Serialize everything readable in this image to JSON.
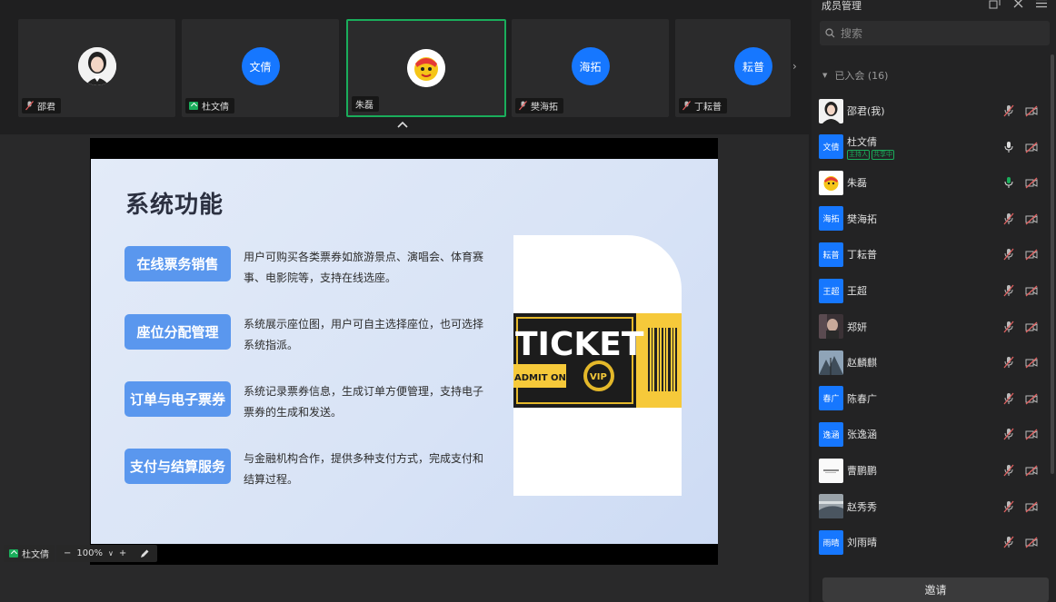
{
  "video_strip": {
    "tiles": [
      {
        "name": "邵君",
        "avatar_type": "photo",
        "muted": true
      },
      {
        "name": "杜文倩",
        "avatar_type": "text",
        "avatar_text": "文倩",
        "sharing": true
      },
      {
        "name": "朱磊",
        "avatar_type": "cartoon",
        "active": true
      },
      {
        "name": "樊海拓",
        "avatar_type": "text",
        "avatar_text": "海拓",
        "muted": true
      },
      {
        "name": "丁耘普",
        "avatar_type": "text",
        "avatar_text": "耘普",
        "muted": true
      }
    ],
    "next_icon": "chevron-right-icon",
    "collapse_icon": "chevron-up-icon"
  },
  "slide": {
    "title": "系统功能",
    "features": [
      {
        "label": "在线票务销售",
        "desc": "用户可购买各类票券如旅游景点、演唱会、体育赛事、电影院等，支持在线选座。"
      },
      {
        "label": "座位分配管理",
        "desc": "系统展示座位图，用户可自主选择座位，也可选择系统指派。"
      },
      {
        "label": "订单与电子票券",
        "desc": "系统记录票券信息，生成订单方便管理，支持电子票券的生成和发送。"
      },
      {
        "label": "支付与结算服务",
        "desc": "与金融机构合作，提供多种支付方式，完成支付和结算过程。"
      }
    ],
    "ticket": {
      "main": "TICKET",
      "admit": "ADMIT ONE",
      "vip": "VIP"
    }
  },
  "bottom_bar": {
    "sharer": "杜文倩",
    "zoom_minus": "−",
    "zoom_level": "100%",
    "zoom_dropdown": "∨",
    "zoom_plus": "+"
  },
  "panel": {
    "title": "成员管理",
    "search_placeholder": "搜索",
    "group_label": "已入会 (16)",
    "members": [
      {
        "name": "邵君(我)",
        "avatar_type": "photo",
        "mic": "muted",
        "camera": "off"
      },
      {
        "name": "杜文倩",
        "avatar_type": "text",
        "avatar_text": "文倩",
        "badges": [
          "主持人",
          "共享中"
        ],
        "mic": "on",
        "camera": "off"
      },
      {
        "name": "朱磊",
        "avatar_type": "cartoon",
        "mic": "speaking",
        "camera": "off"
      },
      {
        "name": "樊海拓",
        "avatar_type": "text",
        "avatar_text": "海拓",
        "mic": "muted",
        "camera": "off"
      },
      {
        "name": "丁耘普",
        "avatar_type": "text",
        "avatar_text": "耘普",
        "mic": "muted",
        "camera": "off"
      },
      {
        "name": "王超",
        "avatar_type": "text",
        "avatar_text": "王超",
        "mic": "muted",
        "camera": "off"
      },
      {
        "name": "郑妍",
        "avatar_type": "photo",
        "mic": "muted",
        "camera": "off"
      },
      {
        "name": "赵麟麒",
        "avatar_type": "photo",
        "mic": "muted",
        "camera": "off"
      },
      {
        "name": "陈春广",
        "avatar_type": "text",
        "avatar_text": "春广",
        "mic": "muted",
        "camera": "off"
      },
      {
        "name": "张逸涵",
        "avatar_type": "text",
        "avatar_text": "逸涵",
        "mic": "muted",
        "camera": "off"
      },
      {
        "name": "曹鹏鹏",
        "avatar_type": "photo",
        "mic": "muted",
        "camera": "off"
      },
      {
        "name": "赵秀秀",
        "avatar_type": "photo",
        "mic": "muted",
        "camera": "off"
      },
      {
        "name": "刘雨晴",
        "avatar_type": "text",
        "avatar_text": "雨晴",
        "mic": "muted",
        "camera": "off"
      }
    ],
    "invite_label": "邀请"
  },
  "colors": {
    "accent_green": "#1aad5b",
    "avatar_blue": "#1677ff",
    "feature_blue": "#5a97ee",
    "muted_orange": "#d9d9d9"
  }
}
